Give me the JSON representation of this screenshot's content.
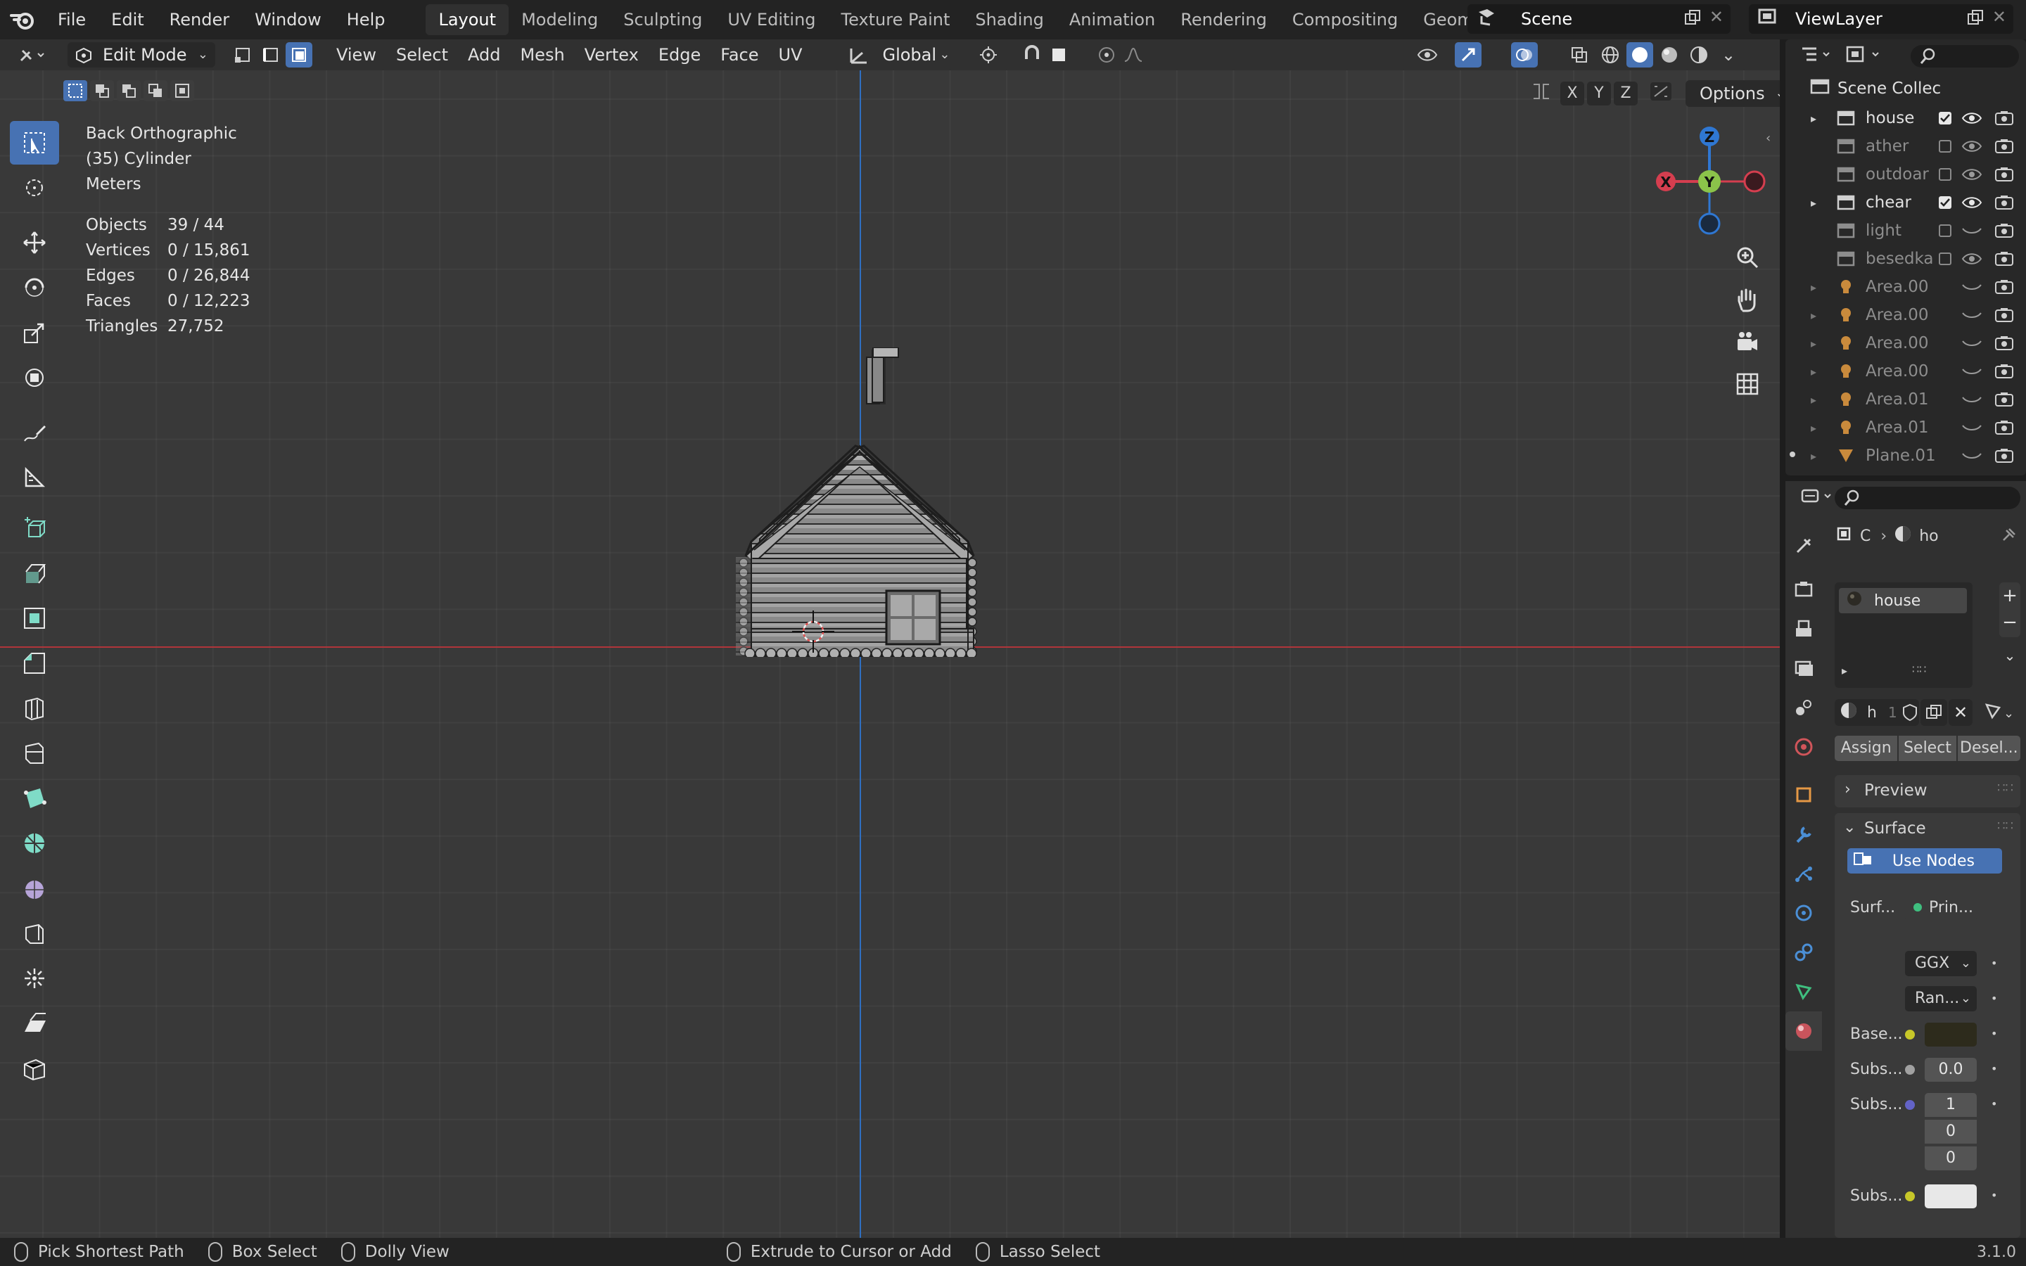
{
  "app": {
    "version": "3.1.0",
    "menu": [
      "File",
      "Edit",
      "Render",
      "Window",
      "Help"
    ]
  },
  "workspaces": [
    "Layout",
    "Modeling",
    "Sculpting",
    "UV Editing",
    "Texture Paint",
    "Shading",
    "Animation",
    "Rendering",
    "Compositing",
    "Geometry Nodes"
  ],
  "active_workspace": "Layout",
  "scene": {
    "name": "Scene",
    "view_layer": "ViewLayer"
  },
  "viewport_header": {
    "mode": "Edit Mode",
    "menus": [
      "View",
      "Select",
      "Add",
      "Mesh",
      "Vertex",
      "Edge",
      "Face",
      "UV"
    ],
    "orientation": "Global",
    "options_label": "Options",
    "axis_buttons": [
      "X",
      "Y",
      "Z"
    ]
  },
  "overlay": {
    "view_name": "Back Orthographic",
    "object_name": "(35) Cylinder",
    "units": "Meters",
    "stats": [
      {
        "label": "Objects",
        "value": "39 / 44"
      },
      {
        "label": "Vertices",
        "value": "0 / 15,861"
      },
      {
        "label": "Edges",
        "value": "0 / 26,844"
      },
      {
        "label": "Faces",
        "value": "0 / 12,223"
      },
      {
        "label": "Triangles",
        "value": "27,752"
      }
    ]
  },
  "gizmo": {
    "z": "Z",
    "y": "Y",
    "x": "X"
  },
  "outliner": {
    "root": "Scene Collec",
    "items": [
      {
        "name": "house",
        "type": "collection",
        "checked": true,
        "dim": false
      },
      {
        "name": "ather",
        "type": "collection",
        "checked": false,
        "dim": true
      },
      {
        "name": "outdoar",
        "type": "collection",
        "checked": false,
        "dim": true
      },
      {
        "name": "chear",
        "type": "collection",
        "checked": true,
        "dim": false
      },
      {
        "name": "light",
        "type": "collection",
        "checked": false,
        "dim": true
      },
      {
        "name": "besedka",
        "type": "collection",
        "checked": false,
        "dim": true
      },
      {
        "name": "Area.00",
        "type": "light",
        "dim": true
      },
      {
        "name": "Area.00",
        "type": "light",
        "dim": true
      },
      {
        "name": "Area.00",
        "type": "light",
        "dim": true
      },
      {
        "name": "Area.00",
        "type": "light",
        "dim": true
      },
      {
        "name": "Area.01",
        "type": "light",
        "dim": true
      },
      {
        "name": "Area.01",
        "type": "light",
        "dim": true
      },
      {
        "name": "Plane.01",
        "type": "mesh",
        "dim": true
      }
    ]
  },
  "properties": {
    "breadcrumb_a": "C",
    "breadcrumb_b": "ho",
    "material_slot": "house",
    "material_field": "h",
    "material_users": "1",
    "buttons": {
      "assign": "Assign",
      "select": "Select",
      "deselect": "Desel..."
    },
    "preview_label": "Preview",
    "surface_label": "Surface",
    "use_nodes": "Use Nodes",
    "surface_field": "Surf...",
    "surface_value": "Prin...",
    "distribution": "GGX",
    "subsurface_method": "Ran...",
    "base_label": "Base...",
    "subs_label_1": "Subs...",
    "subs_value_1": "0.0",
    "subs_label_2": "Subs...",
    "subs_radius": [
      "1",
      "0",
      "0"
    ],
    "subs_label_3": "Subs..."
  },
  "statusbar": {
    "items": [
      "Pick Shortest Path",
      "Box Select",
      "Dolly View",
      "Extrude to Cursor or Add",
      "Lasso Select"
    ],
    "version": "3.1.0"
  }
}
